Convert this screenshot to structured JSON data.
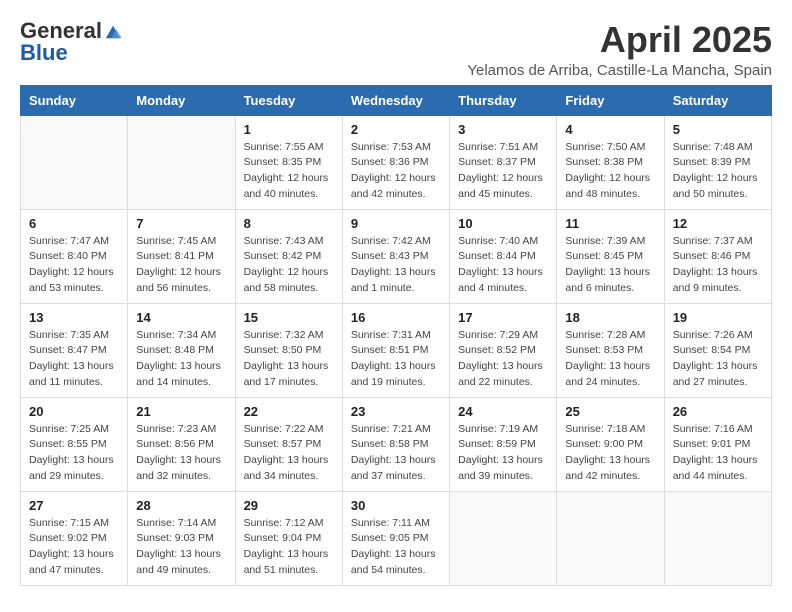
{
  "logo": {
    "general": "General",
    "blue": "Blue"
  },
  "title": "April 2025",
  "location": "Yelamos de Arriba, Castille-La Mancha, Spain",
  "days_of_week": [
    "Sunday",
    "Monday",
    "Tuesday",
    "Wednesday",
    "Thursday",
    "Friday",
    "Saturday"
  ],
  "weeks": [
    [
      {
        "day": "",
        "info": ""
      },
      {
        "day": "",
        "info": ""
      },
      {
        "day": "1",
        "info": "Sunrise: 7:55 AM\nSunset: 8:35 PM\nDaylight: 12 hours and 40 minutes."
      },
      {
        "day": "2",
        "info": "Sunrise: 7:53 AM\nSunset: 8:36 PM\nDaylight: 12 hours and 42 minutes."
      },
      {
        "day": "3",
        "info": "Sunrise: 7:51 AM\nSunset: 8:37 PM\nDaylight: 12 hours and 45 minutes."
      },
      {
        "day": "4",
        "info": "Sunrise: 7:50 AM\nSunset: 8:38 PM\nDaylight: 12 hours and 48 minutes."
      },
      {
        "day": "5",
        "info": "Sunrise: 7:48 AM\nSunset: 8:39 PM\nDaylight: 12 hours and 50 minutes."
      }
    ],
    [
      {
        "day": "6",
        "info": "Sunrise: 7:47 AM\nSunset: 8:40 PM\nDaylight: 12 hours and 53 minutes."
      },
      {
        "day": "7",
        "info": "Sunrise: 7:45 AM\nSunset: 8:41 PM\nDaylight: 12 hours and 56 minutes."
      },
      {
        "day": "8",
        "info": "Sunrise: 7:43 AM\nSunset: 8:42 PM\nDaylight: 12 hours and 58 minutes."
      },
      {
        "day": "9",
        "info": "Sunrise: 7:42 AM\nSunset: 8:43 PM\nDaylight: 13 hours and 1 minute."
      },
      {
        "day": "10",
        "info": "Sunrise: 7:40 AM\nSunset: 8:44 PM\nDaylight: 13 hours and 4 minutes."
      },
      {
        "day": "11",
        "info": "Sunrise: 7:39 AM\nSunset: 8:45 PM\nDaylight: 13 hours and 6 minutes."
      },
      {
        "day": "12",
        "info": "Sunrise: 7:37 AM\nSunset: 8:46 PM\nDaylight: 13 hours and 9 minutes."
      }
    ],
    [
      {
        "day": "13",
        "info": "Sunrise: 7:35 AM\nSunset: 8:47 PM\nDaylight: 13 hours and 11 minutes."
      },
      {
        "day": "14",
        "info": "Sunrise: 7:34 AM\nSunset: 8:48 PM\nDaylight: 13 hours and 14 minutes."
      },
      {
        "day": "15",
        "info": "Sunrise: 7:32 AM\nSunset: 8:50 PM\nDaylight: 13 hours and 17 minutes."
      },
      {
        "day": "16",
        "info": "Sunrise: 7:31 AM\nSunset: 8:51 PM\nDaylight: 13 hours and 19 minutes."
      },
      {
        "day": "17",
        "info": "Sunrise: 7:29 AM\nSunset: 8:52 PM\nDaylight: 13 hours and 22 minutes."
      },
      {
        "day": "18",
        "info": "Sunrise: 7:28 AM\nSunset: 8:53 PM\nDaylight: 13 hours and 24 minutes."
      },
      {
        "day": "19",
        "info": "Sunrise: 7:26 AM\nSunset: 8:54 PM\nDaylight: 13 hours and 27 minutes."
      }
    ],
    [
      {
        "day": "20",
        "info": "Sunrise: 7:25 AM\nSunset: 8:55 PM\nDaylight: 13 hours and 29 minutes."
      },
      {
        "day": "21",
        "info": "Sunrise: 7:23 AM\nSunset: 8:56 PM\nDaylight: 13 hours and 32 minutes."
      },
      {
        "day": "22",
        "info": "Sunrise: 7:22 AM\nSunset: 8:57 PM\nDaylight: 13 hours and 34 minutes."
      },
      {
        "day": "23",
        "info": "Sunrise: 7:21 AM\nSunset: 8:58 PM\nDaylight: 13 hours and 37 minutes."
      },
      {
        "day": "24",
        "info": "Sunrise: 7:19 AM\nSunset: 8:59 PM\nDaylight: 13 hours and 39 minutes."
      },
      {
        "day": "25",
        "info": "Sunrise: 7:18 AM\nSunset: 9:00 PM\nDaylight: 13 hours and 42 minutes."
      },
      {
        "day": "26",
        "info": "Sunrise: 7:16 AM\nSunset: 9:01 PM\nDaylight: 13 hours and 44 minutes."
      }
    ],
    [
      {
        "day": "27",
        "info": "Sunrise: 7:15 AM\nSunset: 9:02 PM\nDaylight: 13 hours and 47 minutes."
      },
      {
        "day": "28",
        "info": "Sunrise: 7:14 AM\nSunset: 9:03 PM\nDaylight: 13 hours and 49 minutes."
      },
      {
        "day": "29",
        "info": "Sunrise: 7:12 AM\nSunset: 9:04 PM\nDaylight: 13 hours and 51 minutes."
      },
      {
        "day": "30",
        "info": "Sunrise: 7:11 AM\nSunset: 9:05 PM\nDaylight: 13 hours and 54 minutes."
      },
      {
        "day": "",
        "info": ""
      },
      {
        "day": "",
        "info": ""
      },
      {
        "day": "",
        "info": ""
      }
    ]
  ]
}
